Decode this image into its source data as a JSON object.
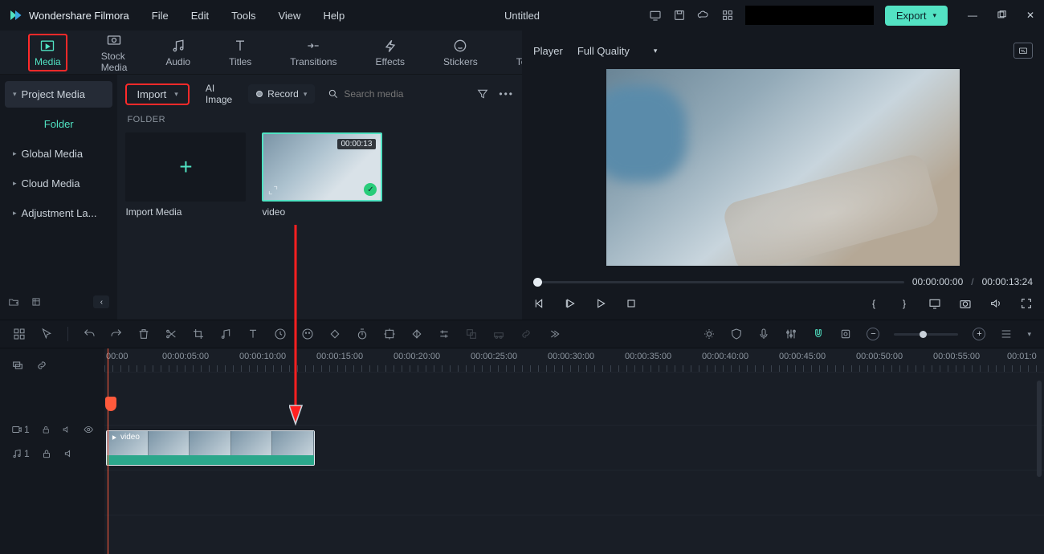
{
  "app": {
    "name": "Wondershare Filmora",
    "document": "Untitled"
  },
  "menu": [
    "File",
    "Edit",
    "Tools",
    "View",
    "Help"
  ],
  "export_label": "Export",
  "tabs": [
    {
      "label": "Media",
      "active": true
    },
    {
      "label": "Stock Media"
    },
    {
      "label": "Audio"
    },
    {
      "label": "Titles"
    },
    {
      "label": "Transitions"
    },
    {
      "label": "Effects"
    },
    {
      "label": "Stickers"
    },
    {
      "label": "Templates"
    }
  ],
  "sidebar": {
    "header": "Project Media",
    "sub": "Folder",
    "items": [
      "Global Media",
      "Cloud Media",
      "Adjustment La..."
    ]
  },
  "toolbar": {
    "import_label": "Import",
    "ai_image": "AI Image",
    "record": "Record",
    "search_placeholder": "Search media"
  },
  "media": {
    "group_label": "FOLDER",
    "import_card": "Import Media",
    "video_card": {
      "name": "video",
      "duration": "00:00:13"
    }
  },
  "preview": {
    "tab": "Player",
    "quality": "Full Quality",
    "current": "00:00:00:00",
    "total": "00:00:13:24"
  },
  "timeline": {
    "ruler": [
      "00:00",
      "00:00:05:00",
      "00:00:10:00",
      "00:00:15:00",
      "00:00:20:00",
      "00:00:25:00",
      "00:00:30:00",
      "00:00:35:00",
      "00:00:40:00",
      "00:00:45:00",
      "00:00:50:00",
      "00:00:55:00",
      "00:01:0"
    ],
    "clip_name": "video",
    "video_track_num": "1",
    "audio_track_num": "1"
  }
}
